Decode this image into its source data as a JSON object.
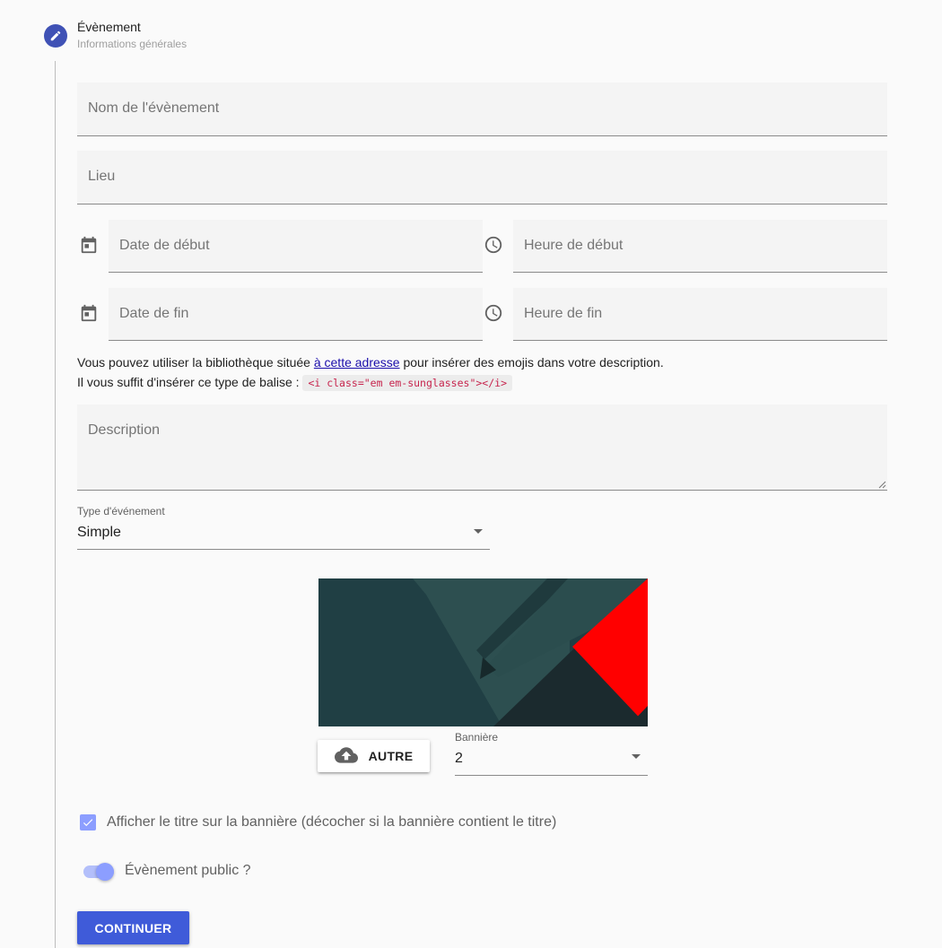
{
  "step": {
    "title": "Évènement",
    "subtitle": "Informations générales",
    "icon": "pencil-icon",
    "accent": "#3f51b5"
  },
  "fields": {
    "name_label": "Nom de l'évènement",
    "place_label": "Lieu",
    "start_date_label": "Date de début",
    "start_time_label": "Heure de début",
    "end_date_label": "Date de fin",
    "end_time_label": "Heure de fin",
    "description_label": "Description"
  },
  "helper": {
    "line1_before": "Vous pouvez utiliser la bibliothèque située ",
    "link": "à cette adresse",
    "line1_after": " pour insérer des emojis dans votre description.",
    "line2": "Il vous suffit d'insérer ce type de balise : ",
    "code": "<i class=\"em em-sunglasses\"></i>"
  },
  "event_type": {
    "label": "Type d'événement",
    "value": "Simple"
  },
  "banner": {
    "upload_label": "AUTRE",
    "upload_icon": "cloud-upload-icon",
    "select_label": "Bannière",
    "select_value": "2",
    "colors": [
      "#203f44",
      "#2d4f50",
      "#1b2a2e",
      "#ff0000"
    ]
  },
  "options": {
    "show_title_label": "Afficher le titre sur la bannière (décocher si la bannière contient le titre)",
    "show_title_checked": true,
    "public_label": "Évènement public ?",
    "public_on": true
  },
  "actions": {
    "continue_label": "CONTINUER"
  }
}
